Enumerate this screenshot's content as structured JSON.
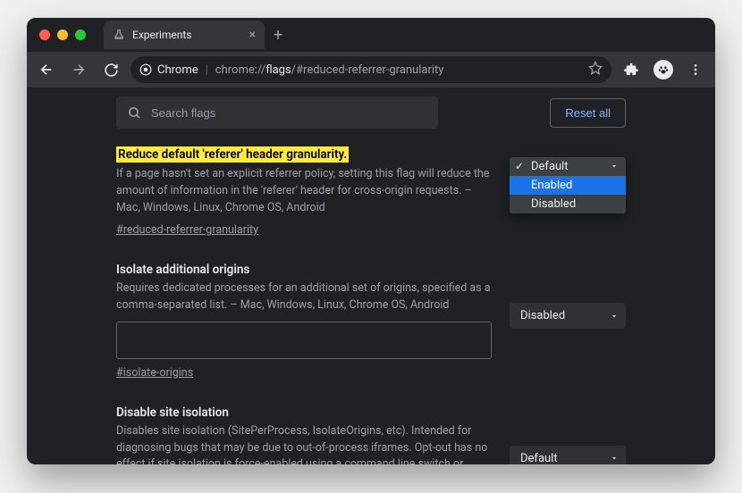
{
  "browser": {
    "tab_title": "Experiments",
    "url_prefix": "Chrome",
    "url_path_prefix": "chrome://",
    "url_path_bold": "flags",
    "url_path_suffix": "/#reduced-referrer-granularity"
  },
  "page": {
    "search_placeholder": "Search flags",
    "reset_label": "Reset all"
  },
  "flags": [
    {
      "title": "Reduce default 'referer' header granularity.",
      "highlighted": true,
      "desc": "If a page hasn't set an explicit referrer policy, setting this flag will reduce the amount of information in the 'referer' header for cross-origin requests. – Mac, Windows, Linux, Chrome OS, Android",
      "hash": "#reduced-referrer-granularity",
      "select_value": "Default",
      "dropdown_open": true,
      "dropdown": {
        "options": [
          "Default",
          "Enabled",
          "Disabled"
        ],
        "current": "Default",
        "hovered": "Enabled"
      }
    },
    {
      "title": "Isolate additional origins",
      "highlighted": false,
      "desc": "Requires dedicated processes for an additional set of origins, specified as a comma-separated list. – Mac, Windows, Linux, Chrome OS, Android",
      "hash": "#isolate-origins",
      "select_value": "Disabled",
      "has_textbox": true
    },
    {
      "title": "Disable site isolation",
      "highlighted": false,
      "desc": "Disables site isolation (SitePerProcess, IsolateOrigins, etc). Intended for diagnosing bugs that may be due to out-of-process iframes. Opt-out has no effect if site isolation is force-enabled using a command line switch or using an enterprise policy. Caution: this disables",
      "hash": "",
      "select_value": "Default"
    }
  ]
}
